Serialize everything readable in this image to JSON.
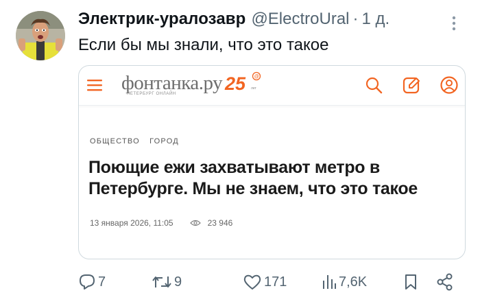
{
  "tweet": {
    "author_name": "Электрик-уралозавр",
    "author_handle": "@ElectroUral",
    "separator": "·",
    "time": "1 д.",
    "text": "Если бы мы знали, что это такое"
  },
  "card": {
    "site_logo": "фонтанка.ру",
    "site_logo_sub": "ПЕТЕРБУРГ ОНЛАЙН",
    "site_badge": "25",
    "tags": [
      "ОБЩЕСТВО",
      "ГОРОД"
    ],
    "headline": "Поющие ежи захватывают метро в Петербурге. Мы не знаем, что это такое",
    "date": "13 января 2026, 11:05",
    "views": "23 946",
    "accent_color": "#f26522"
  },
  "actions": {
    "replies": "7",
    "reposts": "9",
    "likes": "171",
    "views": "7,6K"
  },
  "icons": {
    "more": "more-vertical-icon",
    "menu": "hamburger-menu-icon",
    "search": "search-icon",
    "edit": "edit-icon",
    "profile": "user-icon",
    "reply": "reply-icon",
    "repost": "repost-icon",
    "like": "heart-icon",
    "views": "analytics-icon",
    "bookmark": "bookmark-icon",
    "share": "share-icon"
  }
}
